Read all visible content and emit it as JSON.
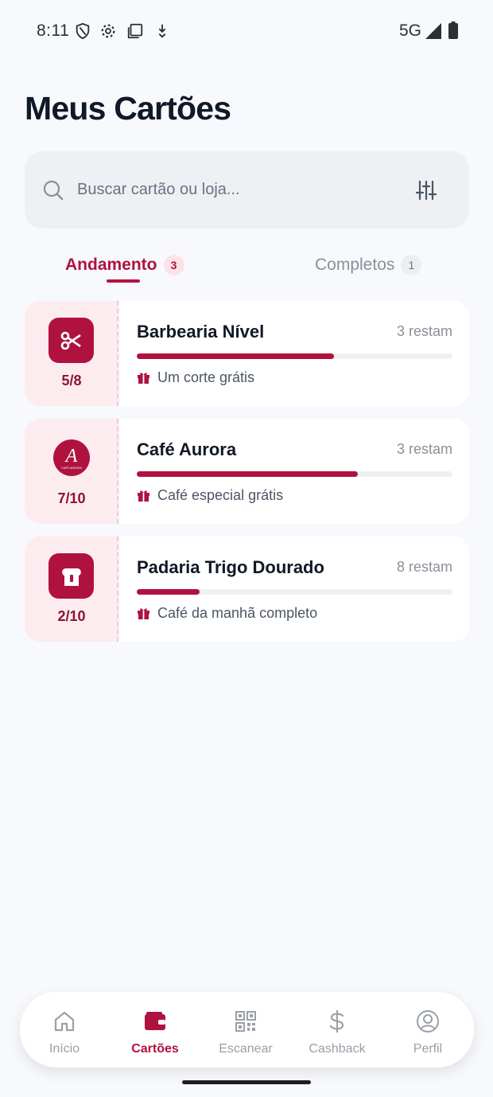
{
  "status_bar": {
    "time": "8:11",
    "network": "5G"
  },
  "page": {
    "title": "Meus Cartões"
  },
  "search": {
    "placeholder": "Buscar cartão ou loja..."
  },
  "tabs": [
    {
      "label": "Andamento",
      "count": "3",
      "active": true
    },
    {
      "label": "Completos",
      "count": "1",
      "active": false
    }
  ],
  "cards": [
    {
      "name": "Barbearia Nível",
      "remaining": "3 restam",
      "stamps": "5/8",
      "progress": 0.625,
      "reward": "Um corte grátis",
      "icon": "scissors-icon"
    },
    {
      "name": "Café Aurora",
      "remaining": "3 restam",
      "stamps": "7/10",
      "progress": 0.7,
      "reward": "Café especial grátis",
      "icon": "cafe-aurora-logo",
      "logo_letter": "A",
      "logo_text": "CAFÉ AURORA"
    },
    {
      "name": "Padaria Trigo Dourado",
      "remaining": "8 restam",
      "stamps": "2/10",
      "progress": 0.2,
      "reward": "Café da manhã completo",
      "icon": "bread-icon"
    }
  ],
  "nav": [
    {
      "label": "Início",
      "icon": "home-icon",
      "active": false
    },
    {
      "label": "Cartões",
      "icon": "wallet-icon",
      "active": true
    },
    {
      "label": "Escanear",
      "icon": "qr-code-icon",
      "active": false
    },
    {
      "label": "Cashback",
      "icon": "dollar-icon",
      "active": false
    },
    {
      "label": "Perfil",
      "icon": "profile-icon",
      "active": false
    }
  ],
  "colors": {
    "accent": "#b0123f",
    "stub_bg": "#fcecf0",
    "background": "#f7f9fc"
  }
}
